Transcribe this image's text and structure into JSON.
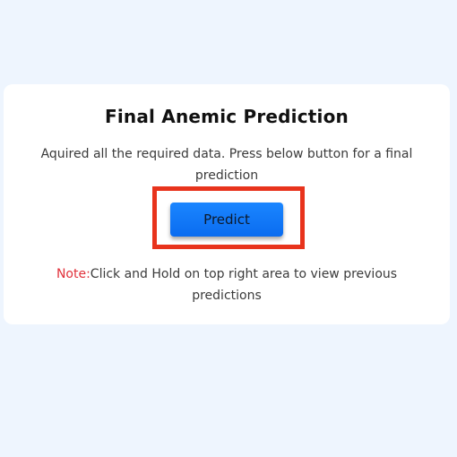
{
  "card": {
    "title": "Final Anemic Prediction",
    "description": "Aquired all the required data. Press below button for a final prediction",
    "predict_button": "Predict",
    "note_label": "Note:",
    "note_text": "Click and Hold on top right area to view previous predictions"
  },
  "colors": {
    "background": "#eef5fe",
    "card": "#ffffff",
    "button": "#0a78ff",
    "highlight_border": "#e8331c",
    "note_label": "#e0303a"
  }
}
